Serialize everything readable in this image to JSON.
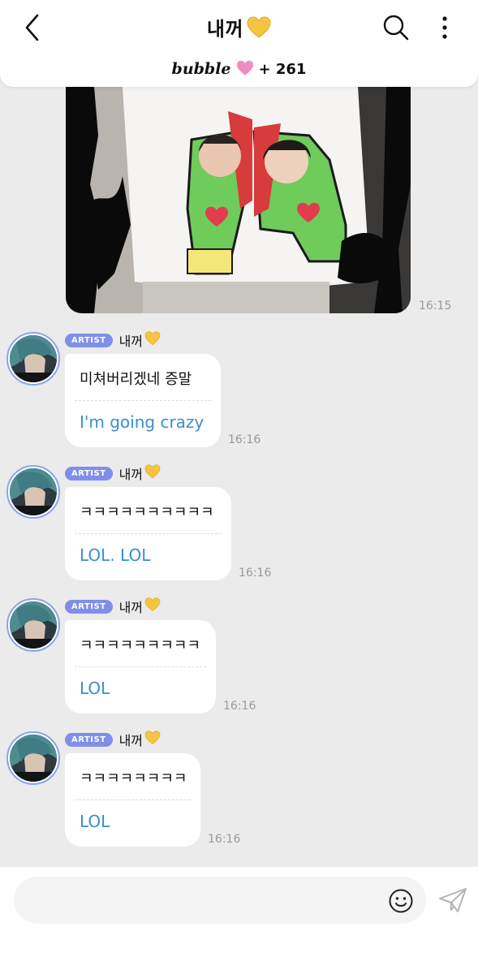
{
  "header": {
    "title": "내꺼",
    "title_emoji_icon": "yellow-heart-icon",
    "back_icon": "chevron-left-icon",
    "search_icon": "search-icon",
    "more_icon": "more-vertical-icon",
    "brand": "bubble",
    "brand_emoji_icon": "pink-heart-icon",
    "subscriber_count": "+ 261"
  },
  "photo_message": {
    "time": "16:15",
    "description_icon": "photo-thumbnail"
  },
  "messages": [
    {
      "badge": "ARTIST",
      "sender": "내꺼",
      "original": "미쳐버리겠네 증말",
      "translation": "I'm going crazy",
      "time": "16:16"
    },
    {
      "badge": "ARTIST",
      "sender": "내꺼",
      "original": "ㅋㅋㅋㅋㅋㅋㅋㅋㅋㅋ",
      "translation": "LOL. LOL",
      "time": "16:16"
    },
    {
      "badge": "ARTIST",
      "sender": "내꺼",
      "original": "ㅋㅋㅋㅋㅋㅋㅋㅋㅋ",
      "translation": "LOL",
      "time": "16:16"
    },
    {
      "badge": "ARTIST",
      "sender": "내꺼",
      "original": "ㅋㅋㅋㅋㅋㅋㅋㅋ",
      "translation": "LOL",
      "time": "16:16"
    }
  ],
  "input": {
    "placeholder": "",
    "emoji_icon": "smiley-icon",
    "send_icon": "paper-plane-icon"
  },
  "colors": {
    "background": "#ebebeb",
    "artist_badge": "#7f8fe9",
    "translation_text": "#3a8fd2",
    "timestamp": "#9a9a9a",
    "yellow_heart": "#f5c542",
    "pink_heart": "#f08cc0"
  }
}
